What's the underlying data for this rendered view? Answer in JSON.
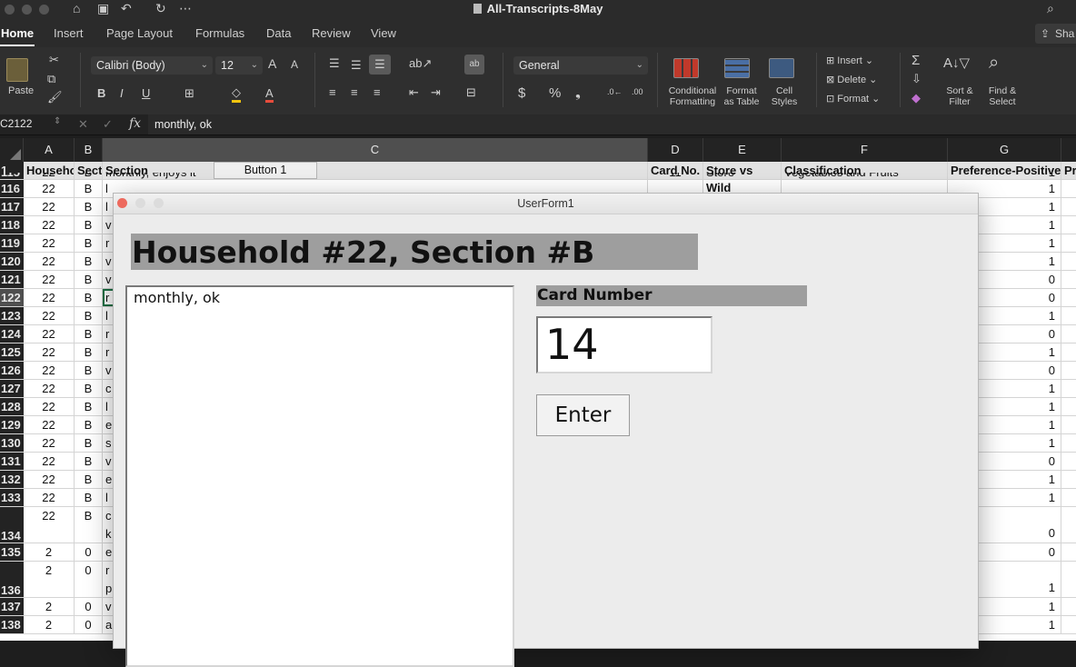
{
  "window": {
    "title": "All-Transcripts-8May",
    "icons": [
      "home-icon",
      "save-icon",
      "undo-icon",
      "redo-icon",
      "more-icon",
      "search-icon"
    ]
  },
  "ribbon": {
    "tabs": [
      "Home",
      "Insert",
      "Page Layout",
      "Formulas",
      "Data",
      "Review",
      "View"
    ],
    "active_tab": "Home",
    "share_label": "Sha",
    "paste_label": "Paste",
    "font_name": "Calibri (Body)",
    "font_size": "12",
    "number_format": "General",
    "conditional_formatting": [
      "Conditional",
      "Formatting"
    ],
    "format_as_table": [
      "Format",
      "as Table"
    ],
    "cell_styles": [
      "Cell",
      "Styles"
    ],
    "insert_label": "Insert",
    "delete_label": "Delete",
    "format_label": "Format",
    "sort_filter": [
      "Sort &",
      "Filter"
    ],
    "find_select": [
      "Find &",
      "Select"
    ]
  },
  "formula_bar": {
    "name_box": "C2122",
    "fx": "fx",
    "content": "monthly, ok"
  },
  "columns": {
    "A": "A",
    "B": "B",
    "C": "C",
    "D": "D",
    "E": "E",
    "F": "F",
    "G": "G"
  },
  "header_row": {
    "row": "1",
    "A": "Househo",
    "B": "Secti",
    "C": "Section",
    "button": "Button 1",
    "D": "Card No.",
    "E": "Store vs Wild",
    "F": "Classification",
    "G": "Preference-Positive",
    "H": "Pr"
  },
  "rows": [
    {
      "n": "115",
      "a": "22",
      "b": "B",
      "c": "monthly, enjoys it",
      "d": "11",
      "e": "Store",
      "f": "Vegetables and Fruits",
      "g": "1"
    },
    {
      "n": "116",
      "a": "22",
      "b": "B",
      "c": "l",
      "g": "1"
    },
    {
      "n": "117",
      "a": "22",
      "b": "B",
      "c": "l",
      "g": "1"
    },
    {
      "n": "118",
      "a": "22",
      "b": "B",
      "c": "v",
      "g": "1"
    },
    {
      "n": "119",
      "a": "22",
      "b": "B",
      "c": "r",
      "g": "1"
    },
    {
      "n": "120",
      "a": "22",
      "b": "B",
      "c": "v",
      "g": "1"
    },
    {
      "n": "121",
      "a": "22",
      "b": "B",
      "c": "v",
      "g": "0"
    },
    {
      "n": "122",
      "a": "22",
      "b": "B",
      "c": "r",
      "g": "0"
    },
    {
      "n": "123",
      "a": "22",
      "b": "B",
      "c": "l",
      "g": "1"
    },
    {
      "n": "124",
      "a": "22",
      "b": "B",
      "c": "r",
      "g": "0"
    },
    {
      "n": "125",
      "a": "22",
      "b": "B",
      "c": "r",
      "g": "1"
    },
    {
      "n": "126",
      "a": "22",
      "b": "B",
      "c": "v",
      "g": "0"
    },
    {
      "n": "127",
      "a": "22",
      "b": "B",
      "c": "c",
      "g": "1"
    },
    {
      "n": "128",
      "a": "22",
      "b": "B",
      "c": "l",
      "g": "1"
    },
    {
      "n": "129",
      "a": "22",
      "b": "B",
      "c": "e",
      "g": "1"
    },
    {
      "n": "130",
      "a": "22",
      "b": "B",
      "c": "s",
      "g": "1"
    },
    {
      "n": "131",
      "a": "22",
      "b": "B",
      "c": "v",
      "g": "0"
    },
    {
      "n": "132",
      "a": "22",
      "b": "B",
      "c": "e",
      "g": "1"
    },
    {
      "n": "133",
      "a": "22",
      "b": "B",
      "c": "l",
      "g": "1"
    },
    {
      "n": "134",
      "a": "22",
      "b": "B",
      "c": "c",
      "c2": "k",
      "g": "0"
    },
    {
      "n": "135",
      "a": "2",
      "b": "0",
      "c": "e",
      "g": "0"
    },
    {
      "n": "136",
      "a": "2",
      "b": "0",
      "c": "r",
      "c2": "p",
      "g": "1"
    },
    {
      "n": "137",
      "a": "2",
      "b": "0",
      "c": "v",
      "g": "1"
    },
    {
      "n": "138",
      "a": "2",
      "b": "0",
      "c": "a",
      "g": "1"
    }
  ],
  "userform": {
    "title": "UserForm1",
    "heading": "Household #22, Section #B",
    "transcript_text": "monthly, ok",
    "card_label": "Card Number",
    "card_value": "14",
    "enter_label": "Enter"
  }
}
